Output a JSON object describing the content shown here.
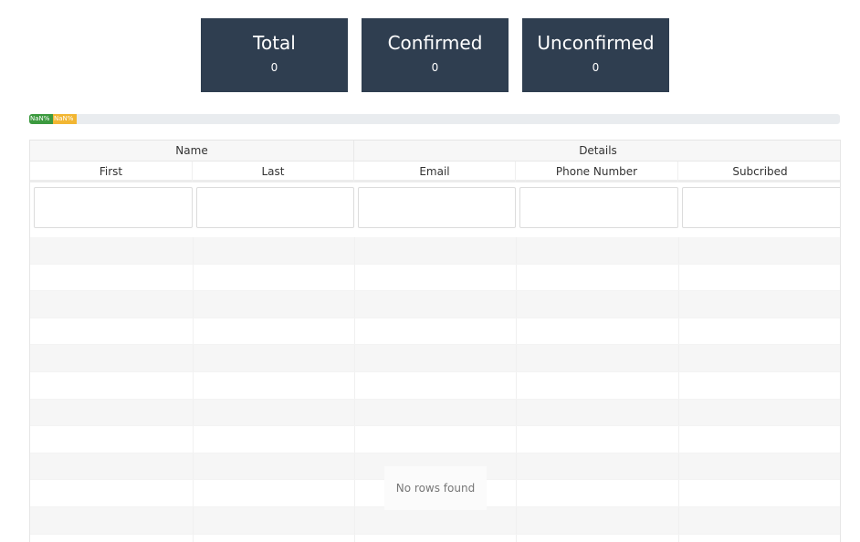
{
  "summary_cards": [
    {
      "title": "Total",
      "count": "0"
    },
    {
      "title": "Confirmed",
      "count": "0"
    },
    {
      "title": "Unconfirmed",
      "count": "0"
    }
  ],
  "progress": {
    "segments": [
      {
        "label": "NaN%",
        "color": "#3c9a3f"
      },
      {
        "label": "NaN%",
        "color": "#f2b632"
      }
    ],
    "track_color": "#e9ecef"
  },
  "table": {
    "groups": [
      "Name",
      "Details"
    ],
    "columns": [
      "First",
      "Last",
      "Email",
      "Phone Number",
      "Subcribed"
    ],
    "empty_message": "No rows found"
  },
  "colors": {
    "card_background": "#2f3e50",
    "card_text": "#ffffff"
  }
}
